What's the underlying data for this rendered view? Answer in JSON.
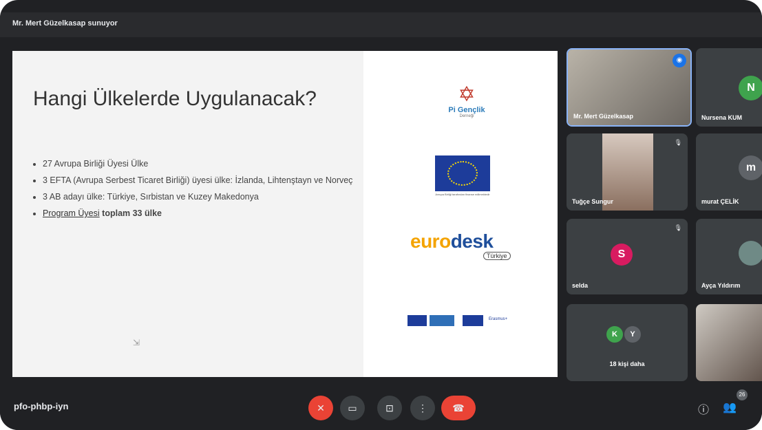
{
  "presenter_banner": "Mr. Mert Güzelkasap sunuyor",
  "slide": {
    "title": "Hangi Ülkelerde Uygulanacak?",
    "bullets": [
      "27 Avrupa Birliği Üyesi Ülke",
      "3 EFTA (Avrupa Serbest Ticaret Birliği) üyesi ülke: İzlanda, Lihtenştayn ve Norveç",
      "3 AB adayı ülke: Türkiye, Sırbistan ve Kuzey Makedonya"
    ],
    "last_bullet_link": "Program Üyesi",
    "last_bullet_bold": "toplam 33 ülke",
    "logos": {
      "pi_name": "Pi Gençlik",
      "pi_sub": "Derneği",
      "eu_caption": "Avrupa Birliği tarafından finanse edilmektedir",
      "eurodesk_a": "euro",
      "eurodesk_b": "desk",
      "eurodesk_sub": "Türkiye",
      "erasmus": "Erasmus+"
    }
  },
  "participants": [
    {
      "name": "Mr. Mert Güzelkasap",
      "speaking": true
    },
    {
      "name": "Nursena KUM",
      "initial": "N",
      "color": "#3fa34d"
    },
    {
      "name": "Tuğçe Sungur",
      "muted": true
    },
    {
      "name": "murat ÇELİK",
      "initial": "m",
      "color": "#5f6368"
    },
    {
      "name": "selda",
      "initial": "S",
      "color": "#d81b60",
      "muted": true
    },
    {
      "name": "Ayça Yıldırım"
    },
    {
      "name": "18 kişi daha",
      "initials": [
        "K",
        "Y"
      ],
      "colors": [
        "#3fa34d",
        "#5f6368"
      ]
    },
    {
      "name": ""
    }
  ],
  "bottom": {
    "meeting_code": "pfo-phbp-iyn",
    "participant_count": "26"
  },
  "icons": [
    "mic-off-icon",
    "camera-icon",
    "present-icon",
    "more-icon",
    "end-call-icon",
    "info-icon",
    "people-icon"
  ]
}
